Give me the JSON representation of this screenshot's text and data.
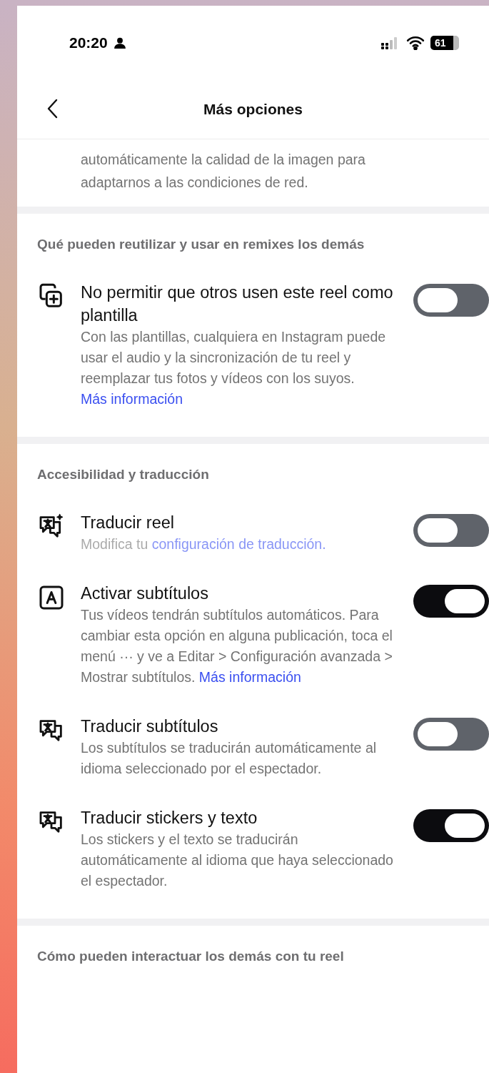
{
  "status_bar": {
    "time": "20:20",
    "battery": "61"
  },
  "nav": {
    "title": "Más opciones"
  },
  "top_note": "automáticamente la calidad de la imagen para adaptarnos a las condiciones de red.",
  "sections": [
    {
      "title": "Qué pueden reutilizar y usar en remixes los demás",
      "items": [
        {
          "kind": "template",
          "title": "No permitir que otros usen este reel como plantilla",
          "on": false,
          "disabled": false,
          "description": [
            {
              "kind": "text",
              "text": "Con las plantillas, cualquiera en Instagram puede usar el audio y la sincronización de tu reel y reemplazar tus fotos y vídeos con los suyos. "
            },
            {
              "kind": "link",
              "text": "Más información"
            }
          ]
        }
      ]
    },
    {
      "title": "Accesibilidad y traducción",
      "items": [
        {
          "kind": "translate-sparkle",
          "title": "Traducir reel",
          "on": false,
          "disabled": true,
          "description": [
            {
              "kind": "text",
              "text": "Modifica tu "
            },
            {
              "kind": "link",
              "text": "configuración de traducción."
            }
          ]
        },
        {
          "kind": "captions",
          "title": "Activar subtítulos",
          "on": true,
          "disabled": false,
          "description": [
            {
              "kind": "text",
              "text": "Tus vídeos tendrán subtítulos automáticos. Para cambiar esta opción en alguna publicación, toca el menú ··· y ve a Editar > Configuración avanzada > Mostrar subtítulos. "
            },
            {
              "kind": "link",
              "text": "Más información"
            }
          ]
        },
        {
          "kind": "translate",
          "title": "Traducir subtítulos",
          "on": false,
          "disabled": false,
          "description": [
            {
              "kind": "text",
              "text": "Los subtítulos se traducirán automáticamente al idioma seleccionado por el espectador."
            }
          ]
        },
        {
          "kind": "translate",
          "title": "Traducir stickers y texto",
          "on": true,
          "disabled": false,
          "description": [
            {
              "kind": "text",
              "text": "Los stickers y el texto se traducirán automáticamente al idioma que haya seleccionado el espectador."
            }
          ]
        }
      ]
    },
    {
      "title": "Cómo pueden interactuar los demás con tu reel"
    }
  ]
}
